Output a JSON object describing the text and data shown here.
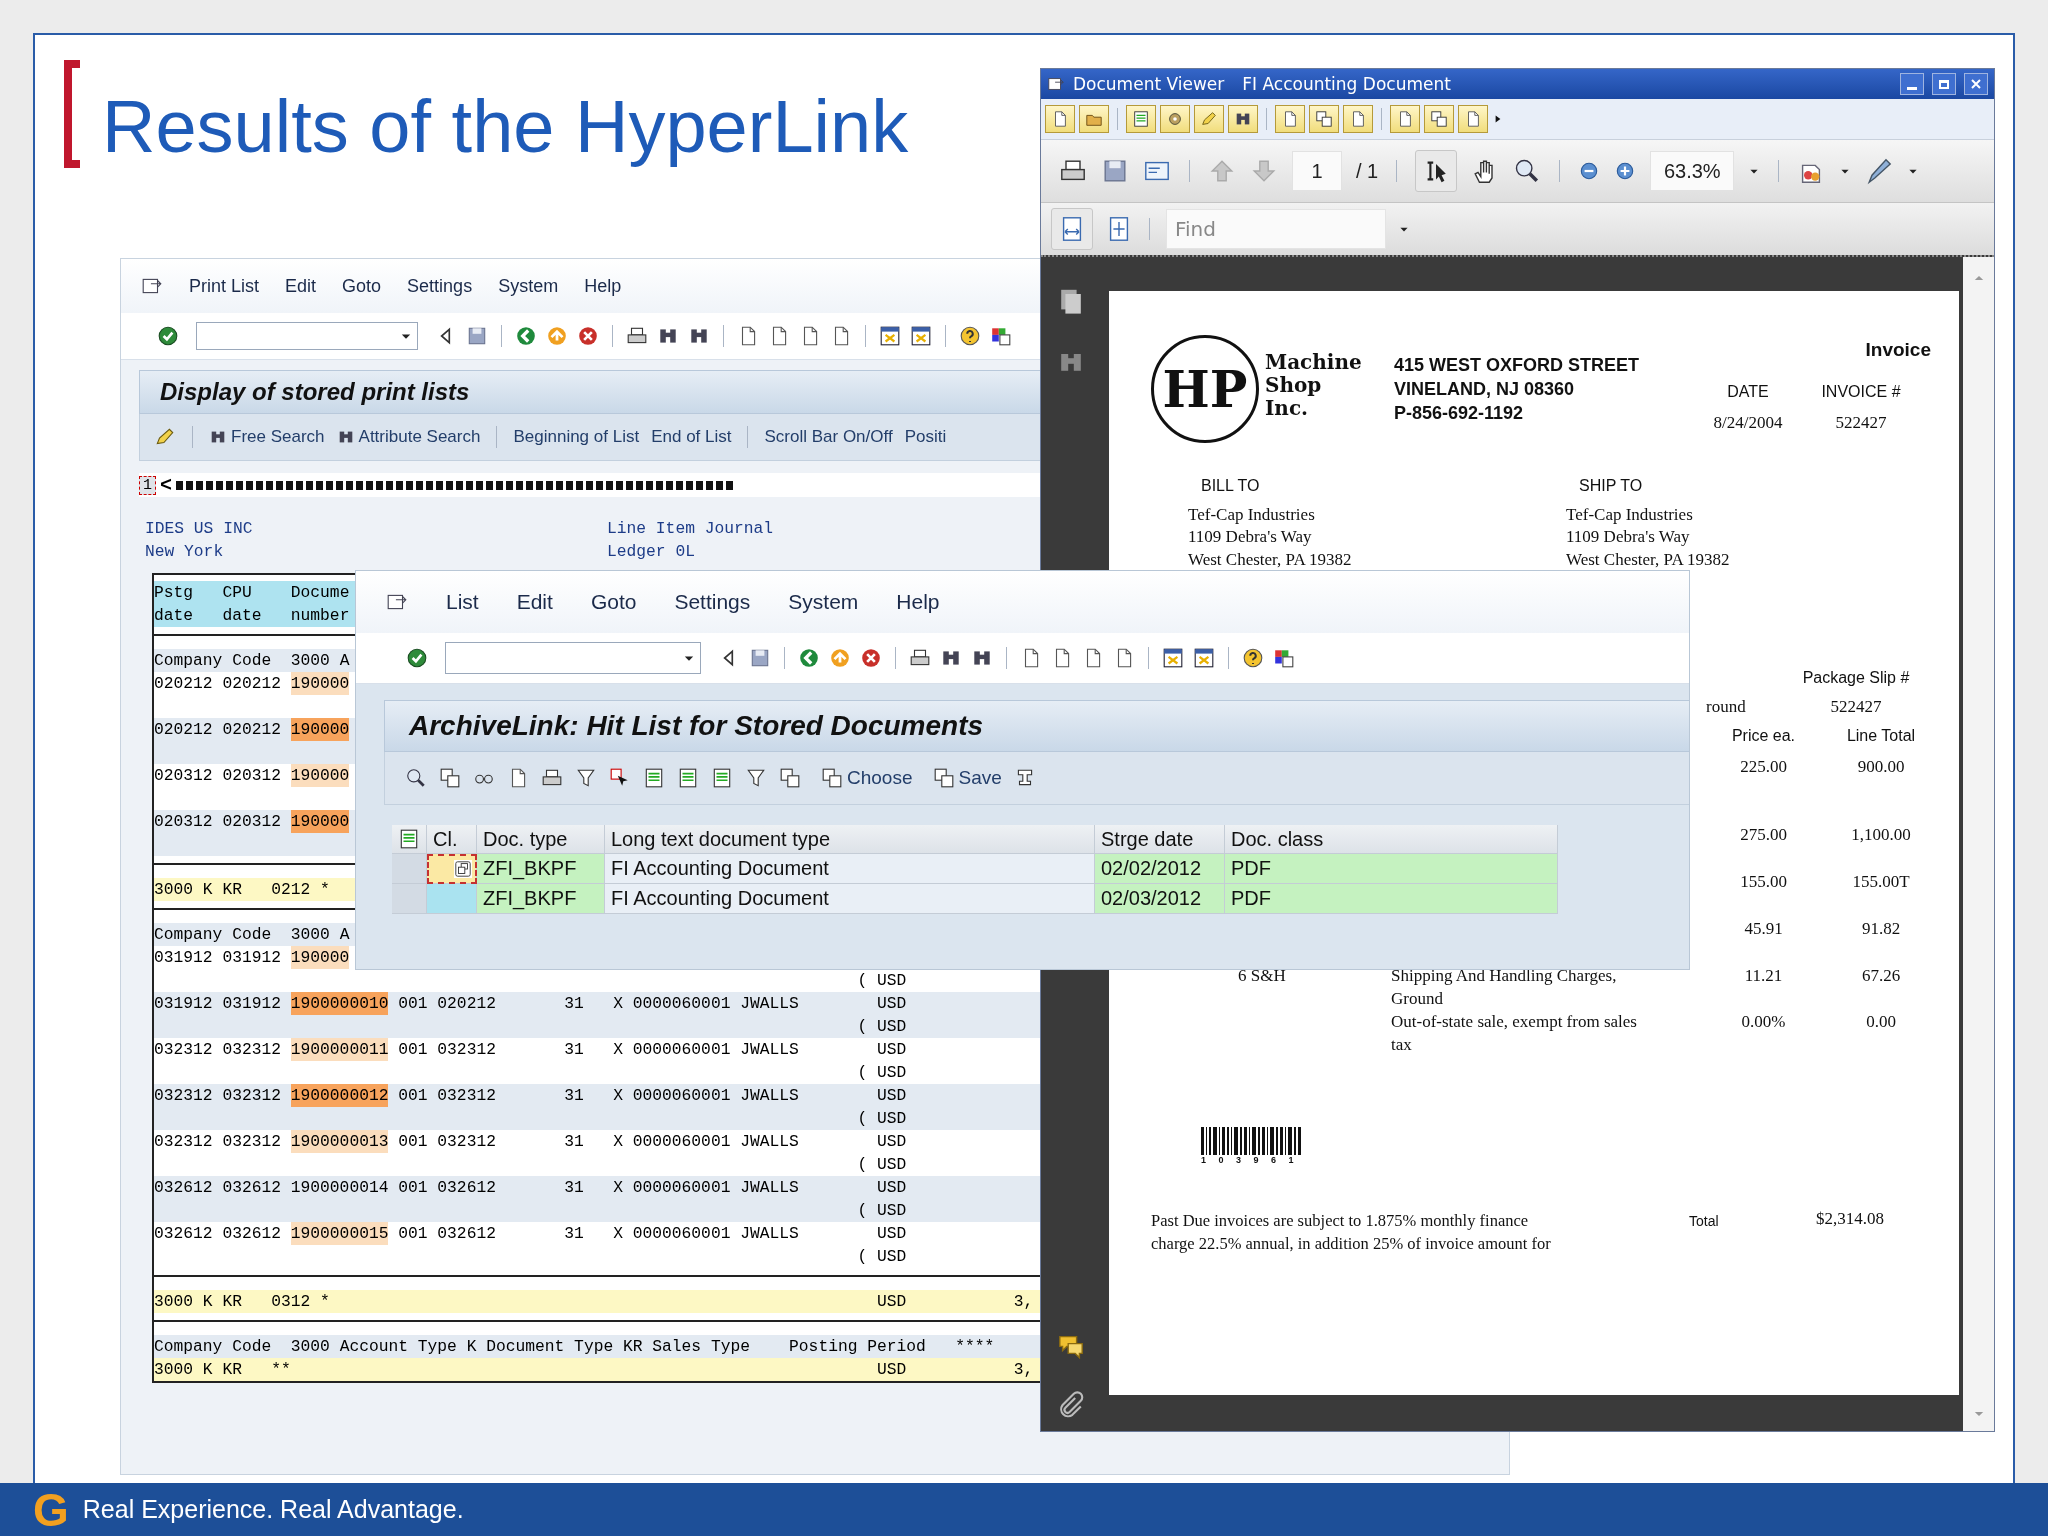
{
  "slide": {
    "title": "Results of the HyperLink",
    "logo": "G",
    "footer": "Real Experience. Real Advantage."
  },
  "print_list_window": {
    "menu": [
      "Print List",
      "Edit",
      "Goto",
      "Settings",
      "System",
      "Help"
    ],
    "title": "Display of stored print lists",
    "app_toolbar_groups": [
      [
        {
          "label": "Free Search",
          "icon": true
        },
        {
          "label": "Attribute Search",
          "icon": true
        }
      ],
      [
        {
          "label": "Beginning of List",
          "icon": false
        },
        {
          "label": "End of List",
          "icon": false
        }
      ],
      [
        {
          "label": "Scroll Bar On/Off",
          "icon": false
        },
        {
          "label": "Positi",
          "icon": false
        }
      ]
    ],
    "ruler": {
      "page": "1",
      "marker": "<"
    },
    "header": {
      "company": "IDES US INC",
      "report": "Line Item Journal",
      "city": "New York",
      "ledger": "Ledger 0L"
    },
    "lines": [
      {
        "kind": "colhead",
        "text": "Pstg   CPU    Docume"
      },
      {
        "kind": "colhead",
        "text": "date   date   number"
      },
      {
        "kind": "rule"
      },
      {
        "kind": "group",
        "text": "Company Code  3000 A"
      },
      {
        "kind": "item",
        "dates": "020212 020212",
        "doc": "190000",
        "color": "#fbddbd"
      },
      {
        "kind": "blank"
      },
      {
        "kind": "item",
        "dates": "020212 020212",
        "doc": "190000",
        "color": "#f7a35c"
      },
      {
        "kind": "blank"
      },
      {
        "kind": "item",
        "dates": "020312 020312",
        "doc": "190000",
        "color": "#fbddbd"
      },
      {
        "kind": "blank"
      },
      {
        "kind": "item",
        "dates": "020312 020312",
        "doc": "190000",
        "color": "#f7a35c"
      },
      {
        "kind": "blank"
      },
      {
        "kind": "rule"
      },
      {
        "kind": "subtotal",
        "text": "3000 K KR   0212 *"
      },
      {
        "kind": "rule"
      },
      {
        "kind": "group",
        "text": "Company Code  3000 A"
      },
      {
        "kind": "item",
        "dates": "031912 031912",
        "doc": "190000",
        "color": "#fbddbd"
      },
      {
        "kind": "note",
        "text": "( USD"
      },
      {
        "kind": "item",
        "dates": "031912 031912",
        "doc": "1900000010",
        "color": "#f7a35c",
        "rest": "001 020212       31   X 0000060001 JWALLS        USD"
      },
      {
        "kind": "note",
        "text": "( USD"
      },
      {
        "kind": "item",
        "dates": "032312 032312",
        "doc": "1900000011",
        "color": "#fbddbd",
        "rest": "001 032312       31   X 0000060001 JWALLS        USD"
      },
      {
        "kind": "note",
        "text": "( USD"
      },
      {
        "kind": "item",
        "dates": "032312 032312",
        "doc": "1900000012",
        "color": "#f7a35c",
        "rest": "001 032312       31   X 0000060001 JWALLS        USD"
      },
      {
        "kind": "note",
        "text": "( USD"
      },
      {
        "kind": "item",
        "dates": "032312 032312",
        "doc": "1900000013",
        "color": "#fbddbd",
        "rest": "001 032312       31   X 0000060001 JWALLS        USD"
      },
      {
        "kind": "note",
        "text": "( USD"
      },
      {
        "kind": "item",
        "dates": "032612 032612",
        "doc": "1900000014",
        "rest": "001 032612       31   X 0000060001 JWALLS        USD"
      },
      {
        "kind": "note",
        "text": "( USD"
      },
      {
        "kind": "item",
        "dates": "032612 032612",
        "doc": "1900000015",
        "color": "#fbddbd",
        "rest": "001 032612       31   X 0000060001 JWALLS        USD"
      },
      {
        "kind": "note",
        "text": "( USD"
      },
      {
        "kind": "rule"
      },
      {
        "kind": "subtotal",
        "text": "3000 K KR   0312 *",
        "currency": "USD",
        "amount": "3,"
      },
      {
        "kind": "rule"
      },
      {
        "kind": "group",
        "text": "Company Code  3000 Account Type K Document Type KR Sales Type    Posting Period   ****"
      },
      {
        "kind": "subtotal",
        "text": "3000 K KR   **",
        "currency": "USD",
        "amount": "3,"
      }
    ]
  },
  "hit_list_window": {
    "menu": [
      "List",
      "Edit",
      "Goto",
      "Settings",
      "System",
      "Help"
    ],
    "title": "ArchiveLink: Hit List for Stored Documents",
    "actions": [
      "Choose",
      "Save"
    ],
    "columns": [
      "Cl.",
      "Doc. type",
      "Long text document type",
      "Strge date",
      "Doc. class"
    ],
    "rows": [
      {
        "focused": true,
        "doc_type": "ZFI_BKPF",
        "long_text": "FI Accounting Document",
        "date": "02/02/2012",
        "doc_class": "PDF"
      },
      {
        "focused": false,
        "doc_type": "ZFI_BKPF",
        "long_text": "FI Accounting Document",
        "date": "02/03/2012",
        "doc_class": "PDF"
      }
    ]
  },
  "viewer": {
    "title": "Document Viewer",
    "subtitle": "FI Accounting Document",
    "page": "1",
    "page_count": "/ 1",
    "zoom": "63.3%",
    "find_placeholder": "Find",
    "invoice": {
      "logo_mark": "HP",
      "logo_lines": [
        "Machine",
        "Shop",
        "Inc."
      ],
      "address": [
        "415 WEST OXFORD STREET",
        "VINELAND, NJ 08360",
        "P-856-692-1192"
      ],
      "heading": "Invoice",
      "meta_labels": [
        "DATE",
        "INVOICE #"
      ],
      "meta_values": [
        "8/24/2004",
        "522427"
      ],
      "bill_to": {
        "label": "BILL TO",
        "lines": [
          "Tef-Cap Industries",
          "1109 Debra's Way",
          "West Chester, PA 19382"
        ]
      },
      "ship_to": {
        "label": "SHIP TO",
        "lines": [
          "Tef-Cap Industries",
          "1109 Debra's Way",
          "West Chester, PA 19382"
        ]
      },
      "slip_label": "Package Slip #",
      "ship_via": "round",
      "slip_number": "522427",
      "price_header": "Price ea.",
      "total_header": "Line Total",
      "items": [
        {
          "price": "225.00",
          "total": "900.00"
        },
        {
          "price": "275.00",
          "total": "1,100.00"
        },
        {
          "price": "155.00",
          "total": "155.00T"
        },
        {
          "price": "45.91",
          "total": "91.82"
        },
        {
          "item": "6 S&H",
          "description": "Shipping And Handling Charges,\nGround",
          "price": "11.21",
          "total": "67.26"
        },
        {
          "description": "Out-of-state sale, exempt from sales\ntax",
          "price": "0.00%",
          "total": "0.00"
        }
      ],
      "barcode_digits": "1 0 3 9 6 1",
      "terms": "Past Due invoices are subject  to 1.875% monthly finance\ncharge 22.5% annual, in addition 25% of invoice amount for",
      "total_label": "Total",
      "total": "$2,314.08"
    }
  }
}
